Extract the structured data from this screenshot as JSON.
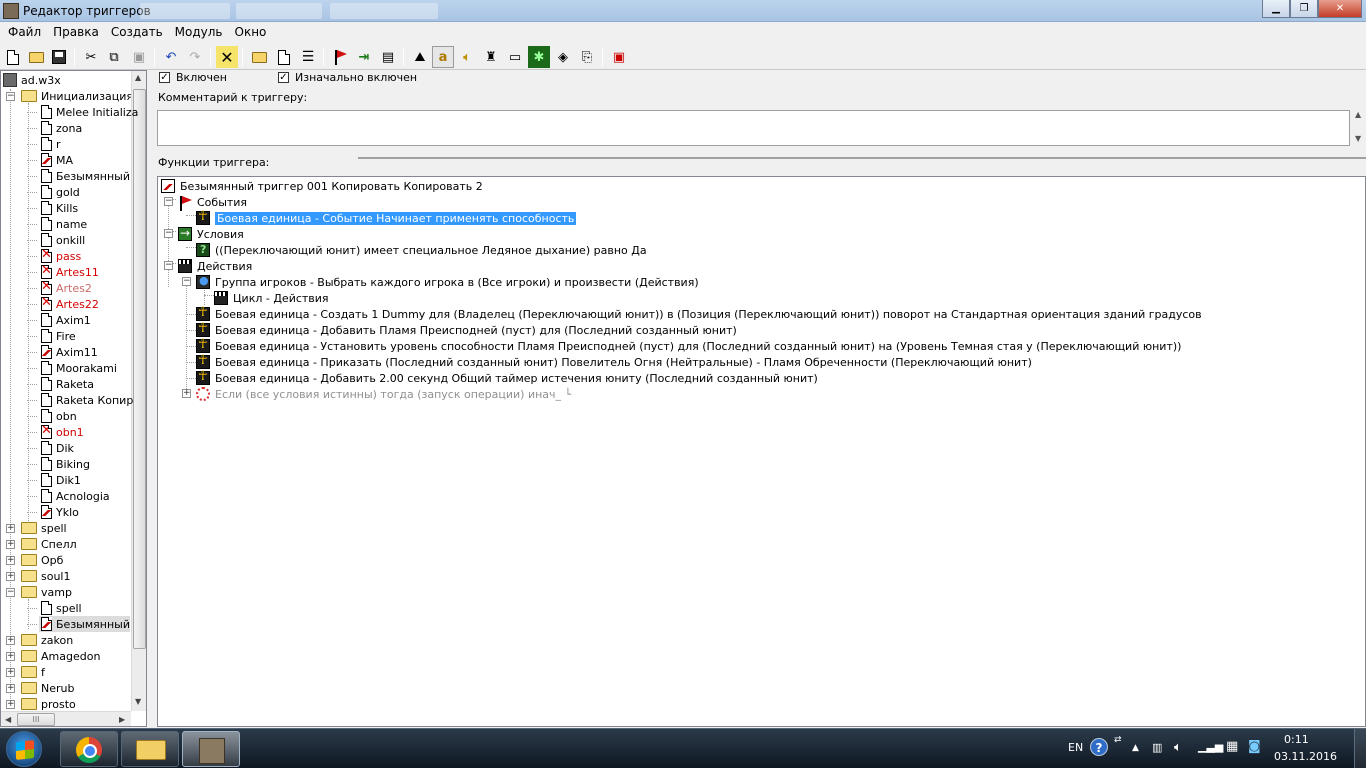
{
  "window": {
    "title": "Редактор триггеров",
    "controls": {
      "minimize": "▁",
      "maximize": "❐",
      "close": "✕"
    }
  },
  "menu": [
    "Файл",
    "Правка",
    "Создать",
    "Модуль",
    "Окно"
  ],
  "toolbar_icons": [
    "new-icon",
    "open-icon",
    "save-icon",
    "cut-icon",
    "copy-icon",
    "paste-icon",
    "undo-icon",
    "redo-icon",
    "delete-icon",
    "new-category-icon",
    "new-trigger-icon",
    "new-comment-icon",
    "new-event-icon",
    "new-condition-icon",
    "new-action-icon",
    "terrain-editor-icon",
    "trigger-editor-icon",
    "sound-editor-icon",
    "object-editor-icon",
    "campaign-editor-icon",
    "ai-editor-icon",
    "object-manager-icon",
    "import-manager-icon",
    "test-map-icon"
  ],
  "tree": {
    "map_name": "ad.w3x",
    "init_folder": "Инициализация",
    "init_items": [
      {
        "label": "Melee Initializa",
        "state": "normal"
      },
      {
        "label": "zona",
        "state": "normal"
      },
      {
        "label": "r",
        "state": "normal"
      },
      {
        "label": "MA",
        "state": "bad"
      },
      {
        "label": "Безымянный",
        "state": "normal"
      },
      {
        "label": "gold",
        "state": "normal"
      },
      {
        "label": "Kills",
        "state": "normal"
      },
      {
        "label": "name",
        "state": "normal"
      },
      {
        "label": "onkill",
        "state": "normal"
      },
      {
        "label": "pass",
        "state": "disabled"
      },
      {
        "label": "Artes11",
        "state": "disabled"
      },
      {
        "label": "Artes2",
        "state": "disabled-dim"
      },
      {
        "label": "Artes22",
        "state": "disabled"
      },
      {
        "label": "Axim1",
        "state": "normal"
      },
      {
        "label": "Fire",
        "state": "normal"
      },
      {
        "label": "Axim11",
        "state": "bad"
      },
      {
        "label": "Moorakami",
        "state": "normal"
      },
      {
        "label": "Raketa",
        "state": "normal"
      },
      {
        "label": "Raketa Копир",
        "state": "normal"
      },
      {
        "label": "obn",
        "state": "normal"
      },
      {
        "label": "obn1",
        "state": "disabled"
      },
      {
        "label": "Dik",
        "state": "normal"
      },
      {
        "label": "Biking",
        "state": "normal"
      },
      {
        "label": "Dik1",
        "state": "normal"
      },
      {
        "label": "Acnologia",
        "state": "normal"
      },
      {
        "label": "Yklo",
        "state": "bad"
      }
    ],
    "folders_a": [
      "spell",
      "Спелл",
      "Орб",
      "soul1"
    ],
    "vamp_folder": "vamp",
    "vamp_items": [
      {
        "label": "spell",
        "state": "normal"
      },
      {
        "label": "Безымянный",
        "state": "bad"
      }
    ],
    "folders_b": [
      "zakon",
      "Amagedon",
      "f",
      "Nerub",
      "prosto"
    ],
    "hscroll_grip": "III"
  },
  "trigger": {
    "enabled_label": "Включен",
    "initially_on_label": "Изначально включен",
    "comment_label": "Комментарий к триггеру:",
    "comment_value": "",
    "functions_label": "Функции триггера:",
    "name": "Безымянный триггер 001 Копировать Копировать 2",
    "events_label": "События",
    "event": "Боевая единица - Событие Начинает применять способность",
    "conditions_label": "Условия",
    "condition": "((Переключающий юнит) имеет специальное Ледяное дыхание) равно Да",
    "actions_label": "Действия",
    "action_group": "Группа игроков - Выбрать каждого игрока в (Все игроки) и произвести (Действия)",
    "loop": "Цикл - Действия",
    "actions": [
      "Боевая единица - Создать 1 Dummy для (Владелец (Переключающий юнит)) в (Позиция (Переключающий юнит)) поворот на Стандартная ориентация зданий градусов",
      "Боевая единица - Добавить Пламя Преисподней (пуст) для (Последний созданный юнит)",
      "Боевая единица - Установить уровень способности Пламя Преисподней (пуст) для (Последний созданный юнит) на (Уровень Темная стая  у (Переключающий юнит))",
      "Боевая единица - Приказать (Последний созданный юнит) Повелитель Огня (Нейтральные) - Пламя Обреченности (Переключающий юнит)",
      "Боевая единица - Добавить 2.00 секунд Общий таймер истечения юниту (Последний созданный юнит)"
    ],
    "ifthen": "Если (все условия истинны) тогда (запуск операции) инач_ └"
  },
  "taskbar": {
    "lang": "EN",
    "help": "?",
    "time": "0:11",
    "date": "03.11.2016"
  }
}
